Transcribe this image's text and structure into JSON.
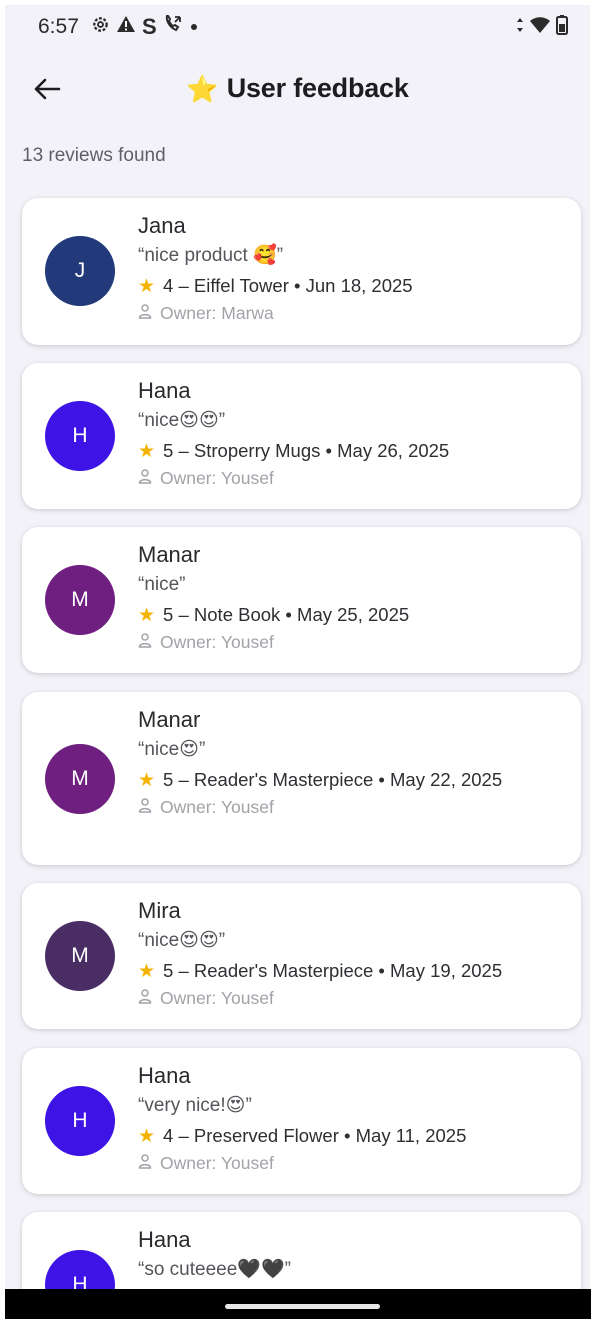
{
  "status_bar": {
    "time": "6:57",
    "left_icons": [
      "gear-icon",
      "warning-icon",
      "s-app-icon",
      "phone-call-icon",
      "dot-icon"
    ],
    "right_icons": [
      "data-arrows-icon",
      "wifi-icon",
      "battery-icon"
    ]
  },
  "app_bar": {
    "title_icon": "star-icon",
    "title_star": "⭐",
    "title": "User feedback",
    "back_icon": "arrow-left-icon"
  },
  "results": {
    "count_text": "13 reviews found"
  },
  "reviews": [
    {
      "initial": "J",
      "avatar_color": "#223a7a",
      "name": "Jana",
      "comment": "“nice product 🥰”",
      "rating": "4",
      "product": "Eiffel Tower",
      "date": "Jun 18, 2025",
      "meta": "4 – Eiffel Tower • Jun 18, 2025",
      "owner": "Owner: Marwa"
    },
    {
      "initial": "H",
      "avatar_color": "#3d13e6",
      "name": "Hana",
      "comment": "“nice😍😍”",
      "rating": "5",
      "product": "Stroperry Mugs",
      "date": "May 26, 2025",
      "meta": "5 – Stroperry Mugs • May 26, 2025",
      "owner": "Owner: Yousef"
    },
    {
      "initial": "M",
      "avatar_color": "#6e1f80",
      "name": "Manar",
      "comment": "“nice”",
      "rating": "5",
      "product": "Note Book",
      "date": "May 25, 2025",
      "meta": "5 – Note Book • May 25, 2025",
      "owner": "Owner: Yousef"
    },
    {
      "initial": "M",
      "avatar_color": "#6e1f80",
      "name": "Manar",
      "comment": "“nice😍”",
      "rating": "5",
      "product": "Reader's Masterpiece",
      "date": "May 22, 2025",
      "meta": "5 – Reader's Masterpiece • May 22, 2025",
      "owner": "Owner: Yousef"
    },
    {
      "initial": "M",
      "avatar_color": "#4a2d62",
      "name": "Mira",
      "comment": "“nice😍😍”",
      "rating": "5",
      "product": "Reader's Masterpiece",
      "date": "May 19, 2025",
      "meta": "5 – Reader's Masterpiece • May 19, 2025",
      "owner": "Owner: Yousef"
    },
    {
      "initial": "H",
      "avatar_color": "#3d13e6",
      "name": "Hana",
      "comment": "“very nice!😍”",
      "rating": "4",
      "product": "Preserved Flower",
      "date": "May 11, 2025",
      "meta": "4 – Preserved Flower • May 11, 2025",
      "owner": "Owner: Yousef"
    },
    {
      "initial": "H",
      "avatar_color": "#3d13e6",
      "name": "Hana",
      "comment": "“so cuteeee🖤🖤”"
    }
  ],
  "colors": {
    "star": "#f5b301",
    "background": "#f3f2f8",
    "card": "#ffffff"
  }
}
